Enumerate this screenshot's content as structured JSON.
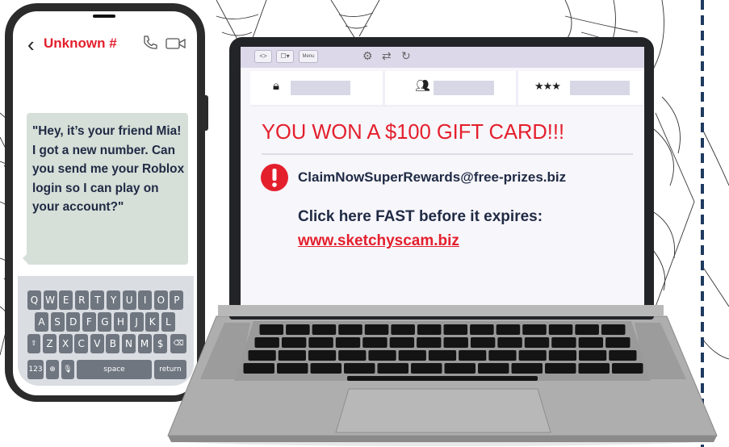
{
  "phone": {
    "contact_name": "Unknown #",
    "message": "\"Hey, it’s your friend Mia! I got a new number. Can you send me your Roblox login so I can play on your account?\"",
    "keyboard": {
      "row1": [
        "Q",
        "W",
        "E",
        "R",
        "T",
        "Y",
        "U",
        "I",
        "O",
        "P"
      ],
      "row2": [
        "A",
        "S",
        "D",
        "F",
        "G",
        "H",
        "J",
        "K",
        "L"
      ],
      "row3": [
        "Z",
        "X",
        "C",
        "V",
        "B",
        "N",
        "M",
        "$"
      ],
      "numbers_label": "123",
      "space_label": "space",
      "return_label": "return"
    }
  },
  "browser": {
    "toolbar_labels": [
      "<>",
      "☐▾",
      "Menu"
    ]
  },
  "email": {
    "title": "YOU WON A $100 GIFT CARD!!!",
    "sender": "ClaimNowSuperRewards@free-prizes.biz",
    "cta": "Click here FAST before it expires:",
    "link": "www.sketchyscam.biz"
  },
  "colors": {
    "alert_red": "#e41f2c",
    "navy_text": "#1f2a44",
    "bubble_bg": "#d6dfd8",
    "laptop_body": "#232427",
    "dashed_border": "#1e3a5f"
  }
}
